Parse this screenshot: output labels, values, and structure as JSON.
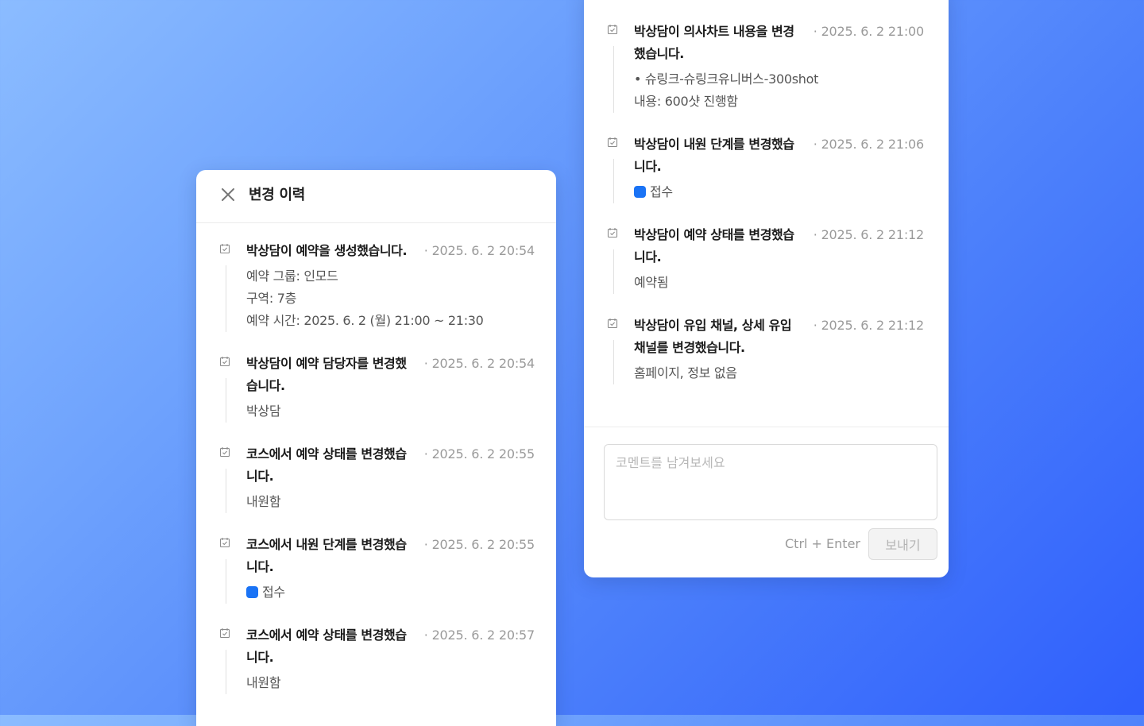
{
  "left_panel": {
    "title": "변경 이력",
    "entries": [
      {
        "title_lines": [
          "박상담이 예약을 생성했습니다."
        ],
        "time": "· 2025. 6. 2 20:54",
        "details": [
          "예약 그룹: 인모드",
          "구역: 7층",
          "예약 시간: 2025. 6. 2 (월) 21:00 ~ 21:30"
        ]
      },
      {
        "title_lines": [
          "박상담이 예약 담당자를 변경했",
          "습니다."
        ],
        "time": "· 2025. 6. 2 20:54",
        "details": [
          "박상담"
        ]
      },
      {
        "title_lines": [
          "코스에서 예약 상태를 변경했습",
          "니다."
        ],
        "time": "· 2025. 6. 2 20:55",
        "details": [
          "내원함"
        ]
      },
      {
        "title_lines": [
          "코스에서 내원 단계를 변경했습",
          "니다."
        ],
        "time": "· 2025. 6. 2 20:55",
        "status_label": "접수"
      },
      {
        "title_lines": [
          "코스에서 예약 상태를 변경했습",
          "니다."
        ],
        "time": "· 2025. 6. 2 20:57",
        "details": [
          "내원함"
        ]
      }
    ]
  },
  "right_panel": {
    "entries": [
      {
        "title_lines": [
          "박상담이 의사차트 내용을 변경",
          "했습니다."
        ],
        "time": "· 2025. 6. 2 21:00",
        "details": [
          "• 슈링크-슈링크유니버스-300shot",
          "내용: 600샷 진행함"
        ]
      },
      {
        "title_lines": [
          "박상담이 내원 단계를 변경했습",
          "니다."
        ],
        "time": "· 2025. 6. 2 21:06",
        "status_label": "접수"
      },
      {
        "title_lines": [
          "박상담이 예약 상태를 변경했습",
          "니다."
        ],
        "time": "· 2025. 6. 2 21:12",
        "details": [
          "예약됨"
        ]
      },
      {
        "title_lines": [
          "박상담이 유입 채널, 상세 유입",
          "채널를 변경했습니다."
        ],
        "time": "· 2025. 6. 2 21:12",
        "details": [
          "홈페이지, 정보 없음"
        ]
      }
    ],
    "comment": {
      "placeholder": "코멘트를 남겨보세요",
      "value": ""
    },
    "shortcut_hint": "Ctrl + Enter",
    "send_label": "보내기"
  },
  "colors": {
    "accent": "#1a73f5",
    "muted_text": "#9a9a9a",
    "detail_text": "#555555"
  },
  "icons": {
    "close": "close-icon",
    "entry": "calendar-check-icon"
  }
}
